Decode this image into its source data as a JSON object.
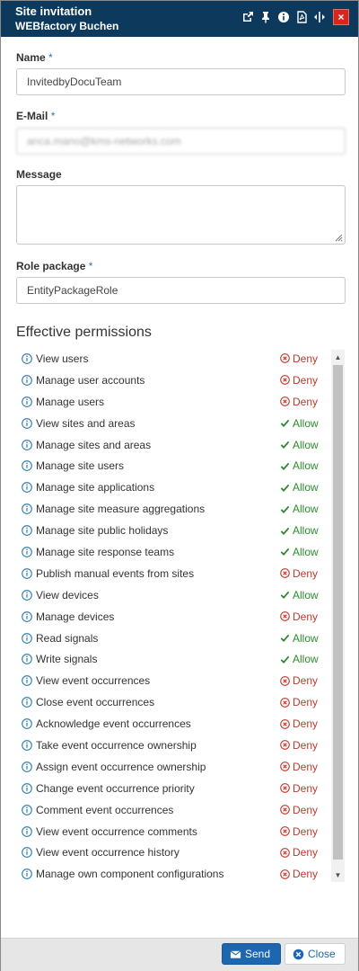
{
  "title": {
    "line1": "Site invitation",
    "line2": "WEBfactory Buchen"
  },
  "form": {
    "name_label": "Name",
    "name_value": "InvitedbyDocuTeam",
    "email_label": "E-Mail",
    "email_value": "anca.mano@kms-networks.com",
    "message_label": "Message",
    "message_value": "",
    "role_label": "Role package",
    "role_value": "EntityPackageRole",
    "required_mark": "*"
  },
  "permissions": {
    "title": "Effective permissions",
    "items": [
      {
        "label": "View users",
        "status": "Deny"
      },
      {
        "label": "Manage user accounts",
        "status": "Deny"
      },
      {
        "label": "Manage users",
        "status": "Deny"
      },
      {
        "label": "View sites and areas",
        "status": "Allow"
      },
      {
        "label": "Manage sites and areas",
        "status": "Allow"
      },
      {
        "label": "Manage site users",
        "status": "Allow"
      },
      {
        "label": "Manage site applications",
        "status": "Allow"
      },
      {
        "label": "Manage site measure aggregations",
        "status": "Allow"
      },
      {
        "label": "Manage site public holidays",
        "status": "Allow"
      },
      {
        "label": "Manage site response teams",
        "status": "Allow"
      },
      {
        "label": "Publish manual events from sites",
        "status": "Deny"
      },
      {
        "label": "View devices",
        "status": "Allow"
      },
      {
        "label": "Manage devices",
        "status": "Deny"
      },
      {
        "label": "Read signals",
        "status": "Allow"
      },
      {
        "label": "Write signals",
        "status": "Allow"
      },
      {
        "label": "View event occurrences",
        "status": "Deny"
      },
      {
        "label": "Close event occurrences",
        "status": "Deny"
      },
      {
        "label": "Acknowledge event occurrences",
        "status": "Deny"
      },
      {
        "label": "Take event occurrence ownership",
        "status": "Deny"
      },
      {
        "label": "Assign event occurrence ownership",
        "status": "Deny"
      },
      {
        "label": "Change event occurrence priority",
        "status": "Deny"
      },
      {
        "label": "Comment event occurrences",
        "status": "Deny"
      },
      {
        "label": "View event occurrence comments",
        "status": "Deny"
      },
      {
        "label": "View event occurrence history",
        "status": "Deny"
      },
      {
        "label": "Manage own component configurations",
        "status": "Deny"
      }
    ]
  },
  "buttons": {
    "send": "Send",
    "close": "Close"
  },
  "colors": {
    "titlebar": "#0d3a5c",
    "deny": "#c0392b",
    "allow": "#2e8b2e",
    "info": "#2a7ab0",
    "primary": "#1d67b0",
    "close_x": "#d8261d"
  },
  "icons": {
    "titlebar": [
      "external-link-icon",
      "pin-icon",
      "info-icon",
      "pdf-icon",
      "resize-icon",
      "close-icon"
    ],
    "permission_info": "info-circle-icon",
    "deny": "x-circle-icon",
    "allow": "checkmark-icon",
    "send": "envelope-icon",
    "close": "times-circle-icon"
  }
}
